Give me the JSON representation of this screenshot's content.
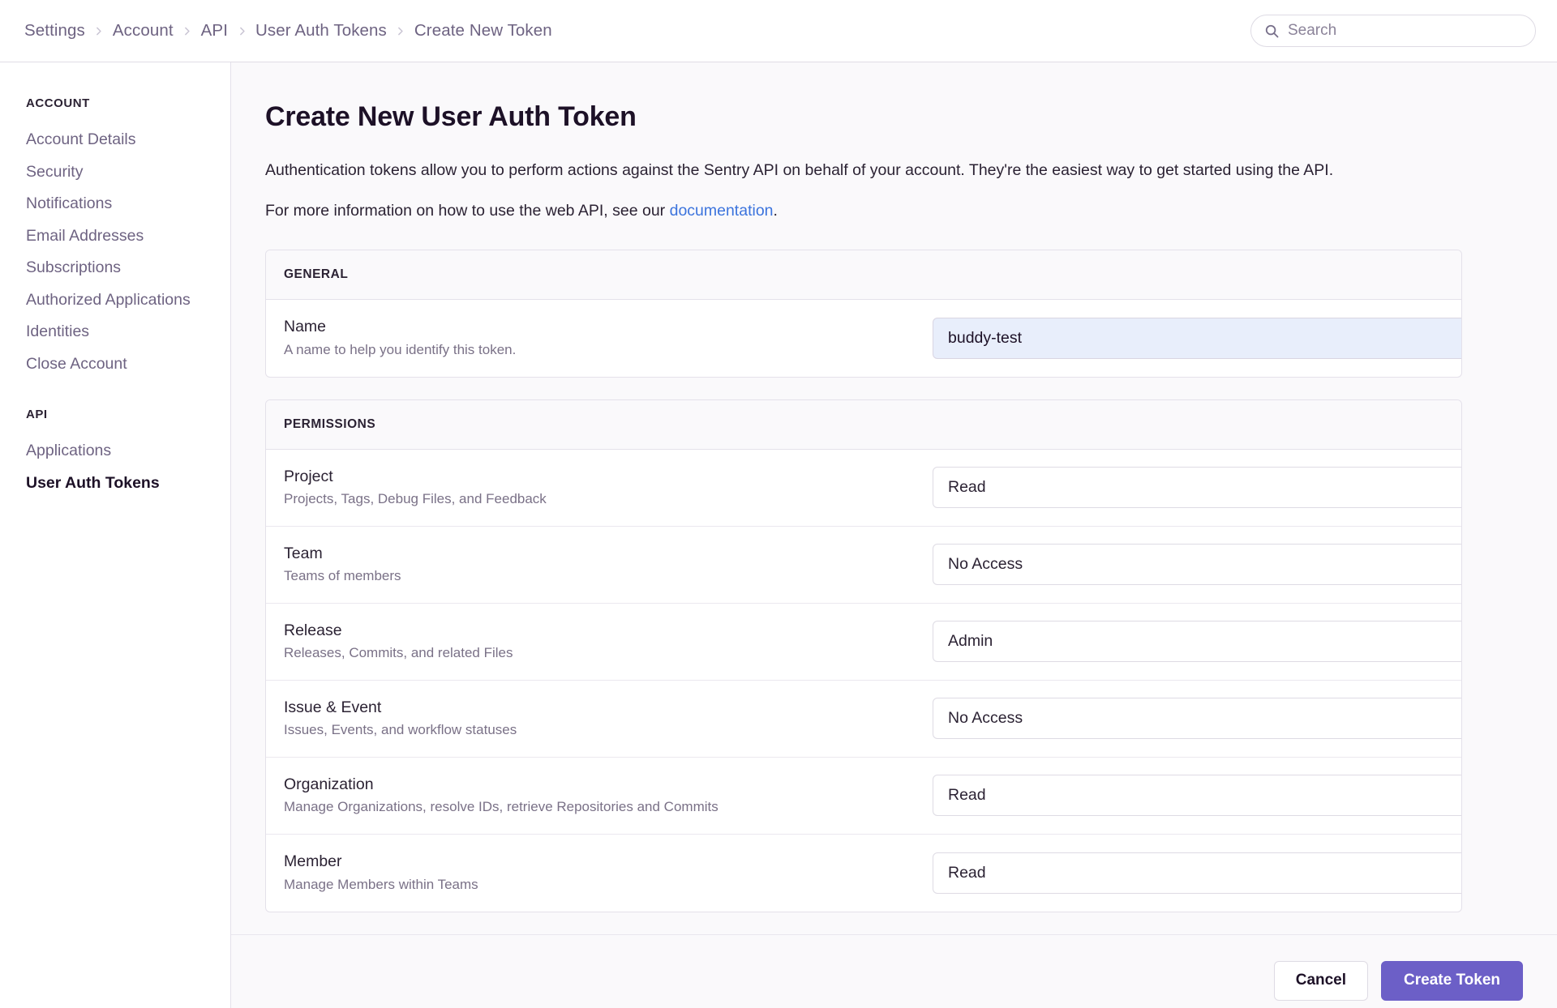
{
  "breadcrumb": {
    "items": [
      {
        "label": "Settings"
      },
      {
        "label": "Account"
      },
      {
        "label": "API"
      },
      {
        "label": "User Auth Tokens"
      },
      {
        "label": "Create New Token"
      }
    ]
  },
  "search": {
    "placeholder": "Search",
    "value": "",
    "icon": "search-icon"
  },
  "sidebar": {
    "groups": [
      {
        "heading": "ACCOUNT",
        "items": [
          {
            "label": "Account Details",
            "active": false
          },
          {
            "label": "Security",
            "active": false
          },
          {
            "label": "Notifications",
            "active": false
          },
          {
            "label": "Email Addresses",
            "active": false
          },
          {
            "label": "Subscriptions",
            "active": false
          },
          {
            "label": "Authorized Applications",
            "active": false
          },
          {
            "label": "Identities",
            "active": false
          },
          {
            "label": "Close Account",
            "active": false
          }
        ]
      },
      {
        "heading": "API",
        "items": [
          {
            "label": "Applications",
            "active": false
          },
          {
            "label": "User Auth Tokens",
            "active": true
          }
        ]
      }
    ]
  },
  "main": {
    "title": "Create New User Auth Token",
    "intro_1": "Authentication tokens allow you to perform actions against the Sentry API on behalf of your account. They're the easiest way to get started using the API.",
    "intro_2_before": "For more information on how to use the web API, see our ",
    "intro_2_link": "documentation",
    "intro_2_after": ".",
    "general": {
      "header": "GENERAL",
      "name_label": "Name",
      "name_help": "A name to help you identify this token.",
      "name_value": "buddy-test",
      "name_placeholder": ""
    },
    "permissions": {
      "header": "PERMISSIONS",
      "rows": [
        {
          "label": "Project",
          "help": "Projects, Tags, Debug Files, and Feedback",
          "value": "Read"
        },
        {
          "label": "Team",
          "help": "Teams of members",
          "value": "No Access"
        },
        {
          "label": "Release",
          "help": "Releases, Commits, and related Files",
          "value": "Admin"
        },
        {
          "label": "Issue & Event",
          "help": "Issues, Events, and workflow statuses",
          "value": "No Access"
        },
        {
          "label": "Organization",
          "help": "Manage Organizations, resolve IDs, retrieve Repositories and Commits",
          "value": "Read"
        },
        {
          "label": "Member",
          "help": "Manage Members within Teams",
          "value": "Read"
        }
      ]
    },
    "actions": {
      "cancel_label": "Cancel",
      "create_label": "Create Token"
    }
  },
  "colors": {
    "accent_purple": "#6c5fc7",
    "link_blue": "#3c74dd",
    "page_bg": "#faf9fb",
    "panel_bg": "#ffffff",
    "border": "#e4e1ea",
    "text_primary": "#1d1127",
    "text_muted": "#6e6382",
    "input_focus_bg": "#e8eefb"
  }
}
